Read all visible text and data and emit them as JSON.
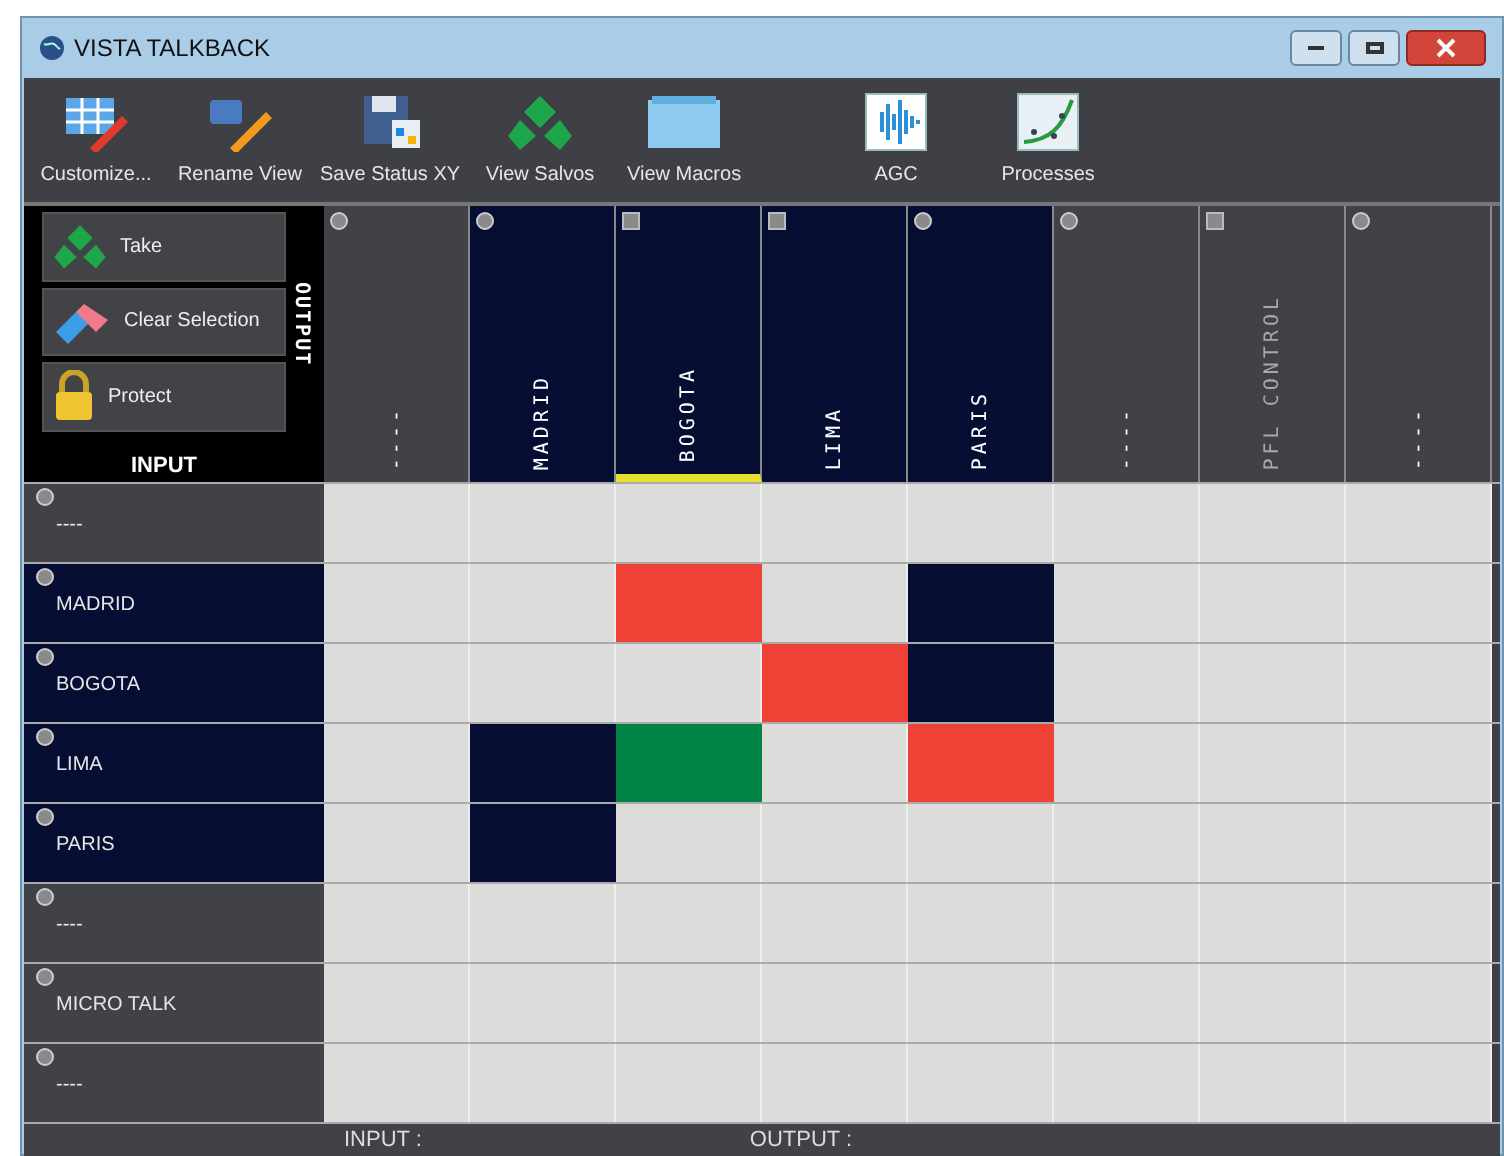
{
  "window": {
    "title": "VISTA TALKBACK"
  },
  "toolbar": [
    {
      "kind": "grid",
      "label": "Customize..."
    },
    {
      "kind": "rename",
      "label": "Rename View"
    },
    {
      "kind": "save",
      "label": "Save Status XY"
    },
    {
      "kind": "salvos",
      "label": "View Salvos"
    },
    {
      "kind": "folder",
      "label": "View Macros"
    },
    {
      "kind": "wave",
      "label": "AGC"
    },
    {
      "kind": "curve",
      "label": "Processes"
    }
  ],
  "actions": [
    {
      "kind": "take",
      "label": "Take"
    },
    {
      "kind": "eraser",
      "label": "Clear Selection"
    },
    {
      "kind": "lock",
      "label": "Protect"
    }
  ],
  "axis_labels": {
    "output": "OUTPUT",
    "input": "INPUT"
  },
  "columns": [
    {
      "label": "----",
      "kind": "circle",
      "active": false,
      "selected": false,
      "dim": false
    },
    {
      "label": "MADRID",
      "kind": "circle",
      "active": true,
      "selected": false,
      "dim": false
    },
    {
      "label": "BOGOTA",
      "kind": "square",
      "active": true,
      "selected": true,
      "dim": false
    },
    {
      "label": "LIMA",
      "kind": "square",
      "active": true,
      "selected": false,
      "dim": false
    },
    {
      "label": "PARIS",
      "kind": "circle",
      "active": true,
      "selected": false,
      "dim": false
    },
    {
      "label": "----",
      "kind": "circle",
      "active": false,
      "selected": false,
      "dim": false
    },
    {
      "label": "PFL CONTROL",
      "kind": "square",
      "active": false,
      "selected": false,
      "dim": true
    },
    {
      "label": "----",
      "kind": "circle",
      "active": false,
      "selected": false,
      "dim": false
    }
  ],
  "rows": [
    {
      "label": "----",
      "active": false,
      "cells": [
        null,
        null,
        null,
        null,
        null,
        null,
        null,
        null
      ]
    },
    {
      "label": "MADRID",
      "active": true,
      "cells": [
        null,
        null,
        {
          "color": "#ef4136"
        },
        null,
        {
          "color": "#050d33"
        },
        null,
        null,
        null
      ]
    },
    {
      "label": "BOGOTA",
      "active": true,
      "cells": [
        null,
        null,
        null,
        {
          "color": "#ef4136"
        },
        {
          "color": "#050d33"
        },
        null,
        null,
        null
      ]
    },
    {
      "label": "LIMA",
      "active": true,
      "cells": [
        null,
        {
          "color": "#050d33"
        },
        {
          "color": "#008546"
        },
        null,
        {
          "color": "#ef4136"
        },
        null,
        null,
        null
      ]
    },
    {
      "label": "PARIS",
      "active": true,
      "cells": [
        null,
        {
          "color": "#050d33"
        },
        null,
        null,
        null,
        null,
        null,
        null
      ]
    },
    {
      "label": "----",
      "active": false,
      "cells": [
        null,
        null,
        null,
        null,
        null,
        null,
        null,
        null
      ]
    },
    {
      "label": "MICRO TALK",
      "active": false,
      "cells": [
        null,
        null,
        null,
        null,
        null,
        null,
        null,
        null
      ]
    },
    {
      "label": "----",
      "active": false,
      "cells": [
        null,
        null,
        null,
        null,
        null,
        null,
        null,
        null
      ]
    }
  ],
  "status_bar": {
    "input": "INPUT :",
    "output": "OUTPUT :"
  }
}
